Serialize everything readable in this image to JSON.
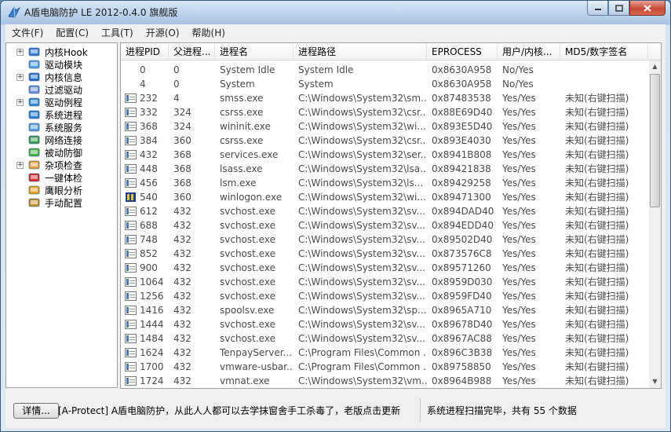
{
  "window": {
    "title": "A盾电脑防护 LE 2012-0.4.0 旗舰版"
  },
  "menu": [
    "文件(F)",
    "配置(C)",
    "工具(T)",
    "开源(O)",
    "帮助(H)"
  ],
  "tree": [
    {
      "label": "内核Hook",
      "expandable": true,
      "icon": "kernel-hook-icon"
    },
    {
      "label": "驱动模块",
      "expandable": false,
      "icon": "driver-module-icon"
    },
    {
      "label": "内核信息",
      "expandable": true,
      "icon": "kernel-info-icon"
    },
    {
      "label": "过滤驱动",
      "expandable": false,
      "icon": "filter-driver-icon"
    },
    {
      "label": "驱动例程",
      "expandable": true,
      "icon": "driver-routine-icon"
    },
    {
      "label": "系统进程",
      "expandable": false,
      "icon": "system-process-icon"
    },
    {
      "label": "系统服务",
      "expandable": false,
      "icon": "system-service-icon"
    },
    {
      "label": "网络连接",
      "expandable": false,
      "icon": "network-icon"
    },
    {
      "label": "被动防御",
      "expandable": false,
      "icon": "passive-defense-icon"
    },
    {
      "label": "杂项检查",
      "expandable": true,
      "icon": "misc-check-icon"
    },
    {
      "label": "一键体检",
      "expandable": false,
      "icon": "one-click-check-icon"
    },
    {
      "label": "鹰眼分析",
      "expandable": false,
      "icon": "eagle-eye-icon"
    },
    {
      "label": "手动配置",
      "expandable": false,
      "icon": "manual-config-icon"
    }
  ],
  "table": {
    "columns": [
      "进程PID",
      "父进程...",
      "进程名",
      "进程路径",
      "EPROCESS",
      "用户/内核...",
      "MD5/数字签名"
    ],
    "rows": [
      [
        "0",
        "0",
        "System Idle",
        "System Idle",
        "0x8630A958",
        "No/Yes",
        ""
      ],
      [
        "4",
        "0",
        "System",
        "System",
        "0x8630A958",
        "No/Yes",
        ""
      ],
      [
        "232",
        "4",
        "smss.exe",
        "C:\\Windows\\System32\\sm...",
        "0x87483538",
        "Yes/Yes",
        "未知(右键扫描)"
      ],
      [
        "332",
        "324",
        "csrss.exe",
        "C:\\Windows\\System32\\csr...",
        "0x88E69D40",
        "Yes/Yes",
        "未知(右键扫描)"
      ],
      [
        "368",
        "324",
        "wininit.exe",
        "C:\\Windows\\System32\\wi...",
        "0x893E5D40",
        "Yes/Yes",
        "未知(右键扫描)"
      ],
      [
        "384",
        "360",
        "csrss.exe",
        "C:\\Windows\\System32\\csr...",
        "0x893E4030",
        "Yes/Yes",
        "未知(右键扫描)"
      ],
      [
        "432",
        "368",
        "services.exe",
        "C:\\Windows\\System32\\ser...",
        "0x8941B808",
        "Yes/Yes",
        "未知(右键扫描)"
      ],
      [
        "448",
        "368",
        "lsass.exe",
        "C:\\Windows\\System32\\lsa...",
        "0x89421838",
        "Yes/Yes",
        "未知(右键扫描)"
      ],
      [
        "456",
        "368",
        "lsm.exe",
        "C:\\Windows\\System32\\ls...",
        "0x89429258",
        "Yes/Yes",
        "未知(右键扫描)"
      ],
      [
        "540",
        "360",
        "winlogon.exe",
        "C:\\Windows\\System32\\wi...",
        "0x89471300",
        "Yes/Yes",
        "未知(右键扫描)"
      ],
      [
        "612",
        "432",
        "svchost.exe",
        "C:\\Windows\\System32\\sv...",
        "0x894DAD40",
        "Yes/Yes",
        "未知(右键扫描)"
      ],
      [
        "688",
        "432",
        "svchost.exe",
        "C:\\Windows\\System32\\sv...",
        "0x894EDD40",
        "Yes/Yes",
        "未知(右键扫描)"
      ],
      [
        "748",
        "432",
        "svchost.exe",
        "C:\\Windows\\System32\\sv...",
        "0x89502D40",
        "Yes/Yes",
        "未知(右键扫描)"
      ],
      [
        "852",
        "432",
        "svchost.exe",
        "C:\\Windows\\System32\\sv...",
        "0x873576C8",
        "Yes/Yes",
        "未知(右键扫描)"
      ],
      [
        "900",
        "432",
        "svchost.exe",
        "C:\\Windows\\System32\\sv...",
        "0x89571260",
        "Yes/Yes",
        "未知(右键扫描)"
      ],
      [
        "1064",
        "432",
        "svchost.exe",
        "C:\\Windows\\System32\\sv...",
        "0x8959D030",
        "Yes/Yes",
        "未知(右键扫描)"
      ],
      [
        "1256",
        "432",
        "svchost.exe",
        "C:\\Windows\\System32\\sv...",
        "0x8959FD40",
        "Yes/Yes",
        "未知(右键扫描)"
      ],
      [
        "1416",
        "432",
        "spoolsv.exe",
        "C:\\Windows\\System32\\sp...",
        "0x8965A710",
        "Yes/Yes",
        "未知(右键扫描)"
      ],
      [
        "1444",
        "432",
        "svchost.exe",
        "C:\\Windows\\System32\\sv...",
        "0x89678D40",
        "Yes/Yes",
        "未知(右键扫描)"
      ],
      [
        "1484",
        "432",
        "svchost.exe",
        "C:\\Windows\\System32\\sv...",
        "0x8967AC88",
        "Yes/Yes",
        "未知(右键扫描)"
      ],
      [
        "1624",
        "432",
        "TenpayServer...",
        "C:\\Program Files\\Common ...",
        "0x896C3B38",
        "Yes/Yes",
        "未知(右键扫描)"
      ],
      [
        "1700",
        "432",
        "vmware-usbar...",
        "C:\\Program Files\\Common ...",
        "0x89758850",
        "Yes/Yes",
        "未知(右键扫描)"
      ],
      [
        "1724",
        "432",
        "vmnat.exe",
        "C:\\Windows\\System32\\vm...",
        "0x8964B988",
        "Yes/Yes",
        "未知(右键扫描)"
      ]
    ]
  },
  "status": {
    "detail_button": "详情...",
    "message": "[A-Protect] A盾电脑防护，从此人人都可以去学抹窗舍手工杀毒了，老版点击更新",
    "right": "系统进程扫描完毕，共有 55 个数据"
  }
}
